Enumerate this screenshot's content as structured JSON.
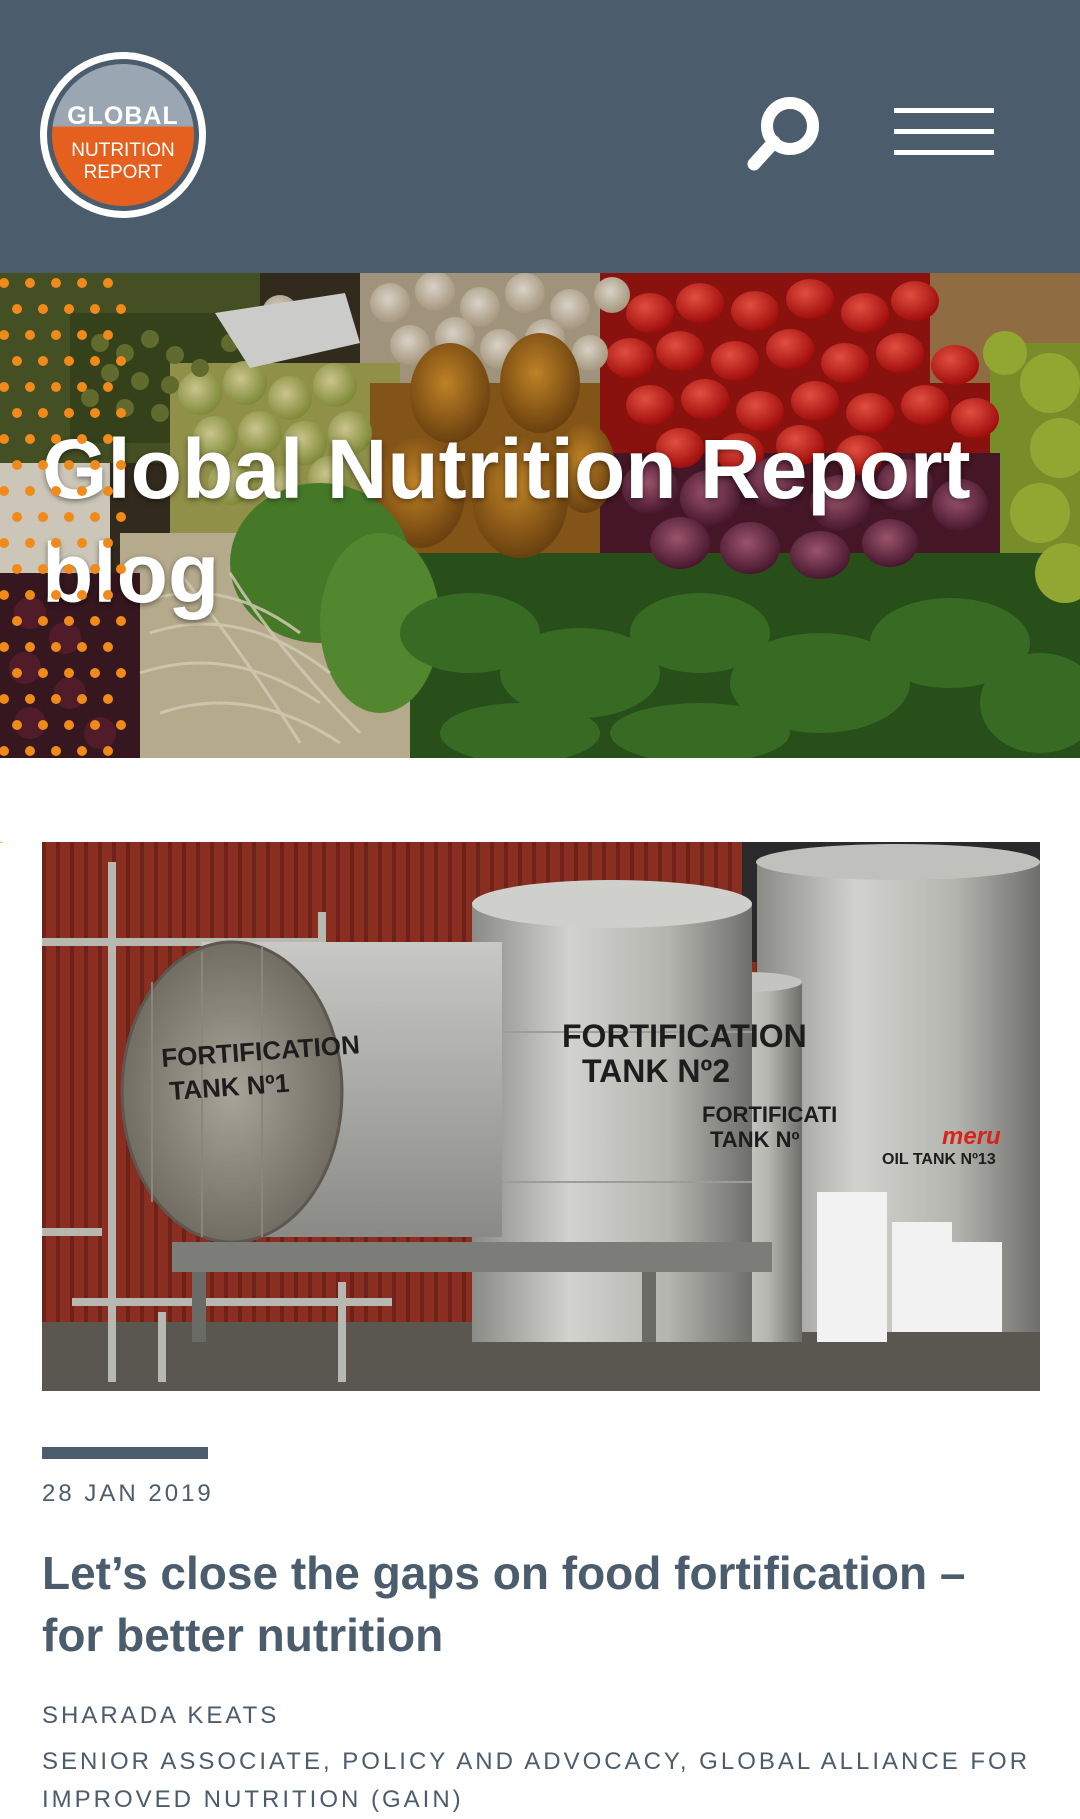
{
  "header": {
    "logo": {
      "line1": "GLOBAL",
      "line2": "NUTRITION",
      "line3": "REPORT"
    },
    "search_icon": "search-icon",
    "menu_icon": "hamburger-menu-icon"
  },
  "hero": {
    "title": "Global Nutrition Report blog"
  },
  "post": {
    "date": "28 JAN 2019",
    "title": "Let’s close the gaps on food fortification – for better nutrition",
    "author": "SHARADA KEATS",
    "author_role": "SENIOR ASSOCIATE, POLICY AND ADVOCACY, GLOBAL ALLIANCE FOR IMPROVED NUTRITION (GAIN)",
    "image": {
      "tank1_label": [
        "FORTIFICATION",
        "TANK Nº1"
      ],
      "tank2_label": [
        "FORTIFICATION",
        "TANK Nº2"
      ],
      "tank3_label": [
        "FORTIFICATI",
        "TANK Nº"
      ],
      "brand": "meru",
      "tank4_label": "OIL TANK Nº13"
    }
  },
  "colors": {
    "header_bg": "#4b5c6d",
    "accent_orange": "#e5601f",
    "text": "#4b5c6d"
  }
}
